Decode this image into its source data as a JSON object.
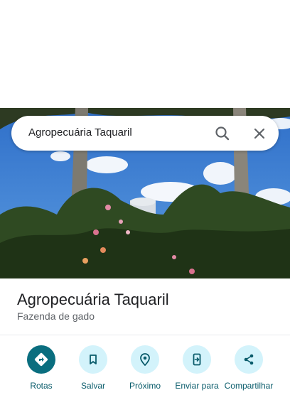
{
  "search": {
    "query": "Agropecuária Taquaril"
  },
  "place": {
    "name": "Agropecuária Taquaril",
    "category": "Fazenda de gado"
  },
  "actions": [
    {
      "label": "Rotas",
      "icon": "directions-icon"
    },
    {
      "label": "Salvar",
      "icon": "bookmark-icon"
    },
    {
      "label": "Próximo",
      "icon": "nearby-icon"
    },
    {
      "label": "Enviar para",
      "icon": "send-to-phone-icon"
    },
    {
      "label": "Compartilhar",
      "icon": "share-icon"
    }
  ],
  "colors": {
    "primary_action": "#0a6e7f",
    "action_tint": "#d3f3fb",
    "action_label": "#0a5c6b"
  }
}
